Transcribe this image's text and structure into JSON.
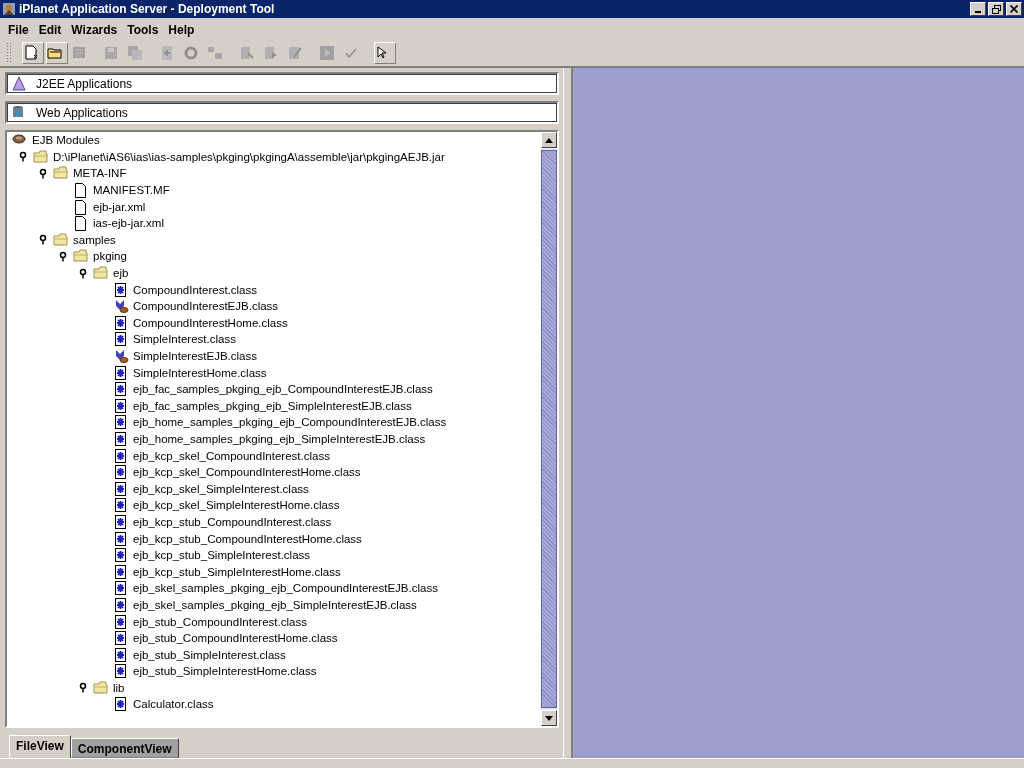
{
  "window": {
    "title": "iPlanet Application Server - Deployment Tool"
  },
  "menu": [
    "File",
    "Edit",
    "Wizards",
    "Tools",
    "Help"
  ],
  "toolbar": [
    [
      {
        "kind": "new",
        "disabled": false
      },
      {
        "kind": "open",
        "disabled": false
      },
      {
        "kind": "properties",
        "disabled": true
      }
    ],
    [
      {
        "kind": "save",
        "disabled": true
      },
      {
        "kind": "save-all",
        "disabled": true
      }
    ],
    [
      {
        "kind": "add",
        "disabled": true
      },
      {
        "kind": "refresh",
        "disabled": true
      },
      {
        "kind": "group",
        "disabled": true
      }
    ],
    [
      {
        "kind": "deploy",
        "disabled": true
      },
      {
        "kind": "undeploy",
        "disabled": true
      },
      {
        "kind": "edit",
        "disabled": true
      }
    ],
    [
      {
        "kind": "run",
        "disabled": true
      },
      {
        "kind": "verify",
        "disabled": true
      }
    ],
    [
      {
        "kind": "help",
        "disabled": false
      }
    ]
  ],
  "sections": [
    {
      "kind": "j2ee",
      "label": "J2EE Applications"
    },
    {
      "kind": "web",
      "label": "Web Applications"
    }
  ],
  "tree": [
    {
      "kind": "module",
      "label": "EJB Modules",
      "children": [
        {
          "kind": "folder",
          "label": "D:\\iPlanet\\iAS6\\ias\\ias-samples\\pkging\\pkgingA\\assemble\\jar\\pkgingAEJB.jar",
          "expanded": true,
          "children": [
            {
              "kind": "folder",
              "label": "META-INF",
              "expanded": true,
              "children": [
                {
                  "kind": "file",
                  "label": "MANIFEST.MF"
                },
                {
                  "kind": "file",
                  "label": "ejb-jar.xml"
                },
                {
                  "kind": "file",
                  "label": "ias-ejb-jar.xml"
                }
              ]
            },
            {
              "kind": "folder",
              "label": "samples",
              "expanded": true,
              "children": [
                {
                  "kind": "folder",
                  "label": "pkging",
                  "expanded": true,
                  "children": [
                    {
                      "kind": "folder",
                      "label": "ejb",
                      "expanded": true,
                      "children": [
                        {
                          "kind": "class",
                          "label": "CompoundInterest.class"
                        },
                        {
                          "kind": "bean",
                          "label": "CompoundInterestEJB.class"
                        },
                        {
                          "kind": "class",
                          "label": "CompoundInterestHome.class"
                        },
                        {
                          "kind": "class",
                          "label": "SimpleInterest.class"
                        },
                        {
                          "kind": "bean",
                          "label": "SimpleInterestEJB.class"
                        },
                        {
                          "kind": "class",
                          "label": "SimpleInterestHome.class"
                        },
                        {
                          "kind": "class",
                          "label": "ejb_fac_samples_pkging_ejb_CompoundInterestEJB.class"
                        },
                        {
                          "kind": "class",
                          "label": "ejb_fac_samples_pkging_ejb_SimpleInterestEJB.class"
                        },
                        {
                          "kind": "class",
                          "label": "ejb_home_samples_pkging_ejb_CompoundInterestEJB.class"
                        },
                        {
                          "kind": "class",
                          "label": "ejb_home_samples_pkging_ejb_SimpleInterestEJB.class"
                        },
                        {
                          "kind": "class",
                          "label": "ejb_kcp_skel_CompoundInterest.class"
                        },
                        {
                          "kind": "class",
                          "label": "ejb_kcp_skel_CompoundInterestHome.class"
                        },
                        {
                          "kind": "class",
                          "label": "ejb_kcp_skel_SimpleInterest.class"
                        },
                        {
                          "kind": "class",
                          "label": "ejb_kcp_skel_SimpleInterestHome.class"
                        },
                        {
                          "kind": "class",
                          "label": "ejb_kcp_stub_CompoundInterest.class"
                        },
                        {
                          "kind": "class",
                          "label": "ejb_kcp_stub_CompoundInterestHome.class"
                        },
                        {
                          "kind": "class",
                          "label": "ejb_kcp_stub_SimpleInterest.class"
                        },
                        {
                          "kind": "class",
                          "label": "ejb_kcp_stub_SimpleInterestHome.class"
                        },
                        {
                          "kind": "class",
                          "label": "ejb_skel_samples_pkging_ejb_CompoundInterestEJB.class"
                        },
                        {
                          "kind": "class",
                          "label": "ejb_skel_samples_pkging_ejb_SimpleInterestEJB.class"
                        },
                        {
                          "kind": "class",
                          "label": "ejb_stub_CompoundInterest.class"
                        },
                        {
                          "kind": "class",
                          "label": "ejb_stub_CompoundInterestHome.class"
                        },
                        {
                          "kind": "class",
                          "label": "ejb_stub_SimpleInterest.class"
                        },
                        {
                          "kind": "class",
                          "label": "ejb_stub_SimpleInterestHome.class"
                        }
                      ]
                    },
                    {
                      "kind": "folder",
                      "label": "lib",
                      "expanded": true,
                      "children": [
                        {
                          "kind": "class",
                          "label": "Calculator.class"
                        }
                      ]
                    }
                  ]
                }
              ]
            }
          ]
        }
      ]
    }
  ],
  "tabs": [
    {
      "label": "FileView",
      "selected": true
    },
    {
      "label": "ComponentView",
      "selected": false
    }
  ]
}
